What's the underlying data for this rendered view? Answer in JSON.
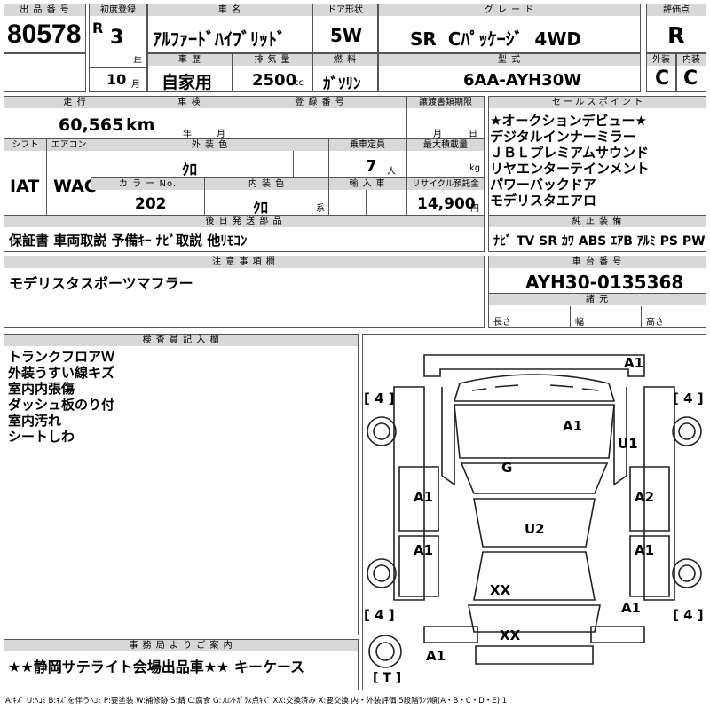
{
  "header": {
    "lot_no_label": "出 品 番 号",
    "lot_no": "80578",
    "first_reg_label": "初度登録",
    "era": "R",
    "year": "3",
    "year_unit": "年",
    "month": "10",
    "month_unit": "月",
    "car_name_label": "車 名",
    "car_name": "ｱﾙﾌｧｰﾄﾞﾊｲﾌﾞﾘｯﾄﾞ",
    "door_label": "ドア形状",
    "door": "5W",
    "grade_label": "グ レ ー ド",
    "grade": "SR Cﾊﾟｯｹｰｼﾞ 4WD",
    "score_label": "評価点",
    "score": "R",
    "history_label": "車 歴",
    "history": "自家用",
    "displacement_label": "排 気 量",
    "displacement": "2500",
    "displacement_unit": "cc",
    "fuel_label": "燃 料",
    "fuel": "ｶﾞｿﾘﾝ",
    "model_label": "型 式",
    "model": "6AA-AYH30W",
    "exterior_label": "外装",
    "exterior_score": "C",
    "interior_label": "内装",
    "interior_score": "C"
  },
  "info": {
    "mileage_label": "走 行",
    "mileage": "60,565",
    "mileage_unit": "km",
    "inspection_label": "車 検",
    "inspection_year_unit": "年",
    "inspection_month_unit": "月",
    "reg_no_label": "登 録 番 号",
    "transfer_label": "譲渡書類期限",
    "transfer_month_unit": "月",
    "transfer_day_unit": "日",
    "shift_label": "シフト",
    "shift": "IAT",
    "ac_label": "エアコン",
    "ac": "WAC",
    "ext_color_label": "外 装 色",
    "ext_color": "ｸﾛ",
    "capacity_label": "乗車定員",
    "capacity": "7",
    "capacity_unit": "人",
    "max_load_label": "最大積載量",
    "max_load_unit": "kg",
    "color_no_label": "カ ラ ー No.",
    "color_no": "202",
    "int_color_label": "内 装 色",
    "int_color": "ｸﾛ",
    "int_color_unit": "系",
    "import_label": "輸 入 車",
    "recycle_label": "リサイクル預託金",
    "recycle": "14,900",
    "recycle_unit": "円",
    "later_parts_label": "後 日 発 送 部 品",
    "later_parts": "保証書 車両取説 予備ｷｰ ﾅﾋﾞ取説 他ﾘﾓｺﾝ"
  },
  "selling_points": {
    "label": "セ ー ル ス ポ イ ン ト",
    "lines": [
      "★オークションデビュー★",
      "デジタルインナーミラー",
      "ＪＢＬプレミアムサウンド",
      "リヤエンターテインメント",
      "パワーバックドア",
      "モデリスタエアロ"
    ]
  },
  "equipment": {
    "label": "純 正 装 備",
    "items": "ﾅﾋﾞ TV SR ｶﾜ ABS ｴｱB ｱﾙﾐ PS PW"
  },
  "notes": {
    "label": "注 意 事 項 欄",
    "text": "モデリスタスポーツマフラー"
  },
  "chassis": {
    "label": "車 台 番 号",
    "number": "AYH30-0135368",
    "dims_label": "諸 元",
    "length_label": "長さ",
    "width_label": "幅",
    "height_label": "高さ"
  },
  "inspector": {
    "label": "検 査 員 記 入 欄",
    "lines": [
      "トランクフロアＷ",
      "外装うすい線キズ",
      "室内内張傷",
      "ダッシュ板のり付",
      "室内汚れ",
      "シートしわ"
    ]
  },
  "office": {
    "label": "事 務 局 よ り ご 案 内",
    "text": "★★静岡サテライト会場出品車★★ キーケース"
  },
  "diagram": {
    "marks": {
      "rear_top": "A1",
      "roof": "A1",
      "right_upper": "U1",
      "glass": "G",
      "left_front_door": "A1",
      "right_front_door": "A2",
      "floor": "U2",
      "left_rear_door": "A1",
      "right_rear_door": "A1",
      "rear_roof": "XX",
      "right_lower": "A1",
      "front_bumper": "XX",
      "front_left": "A1"
    },
    "tire_fl": "[ 4 ]",
    "tire_fr": "[ 4 ]",
    "tire_rl": "[ 4 ]",
    "tire_rr": "[ 4 ]",
    "spare": "[ T ]"
  },
  "legend": "A:ｷｽﾞ U:ﾍｺﾐ B:ｷｽﾞを伴うﾍｺﾐ P:要塗装 W:補修跡 S:錆 C:腐食 G:ﾌﾛﾝﾄｶﾞﾗｽ点ｷｽﾞ XX:交換済み X:要交換 内・外装評価 5段階ﾗﾝｸ順(A・B・C・D・E) 1"
}
